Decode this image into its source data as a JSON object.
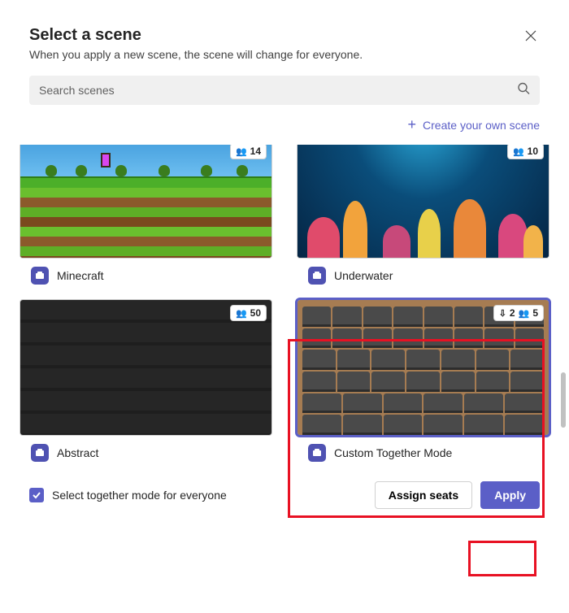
{
  "header": {
    "title": "Select a scene",
    "subtitle": "When you apply a new scene, the scene will change for everyone."
  },
  "search": {
    "placeholder": "Search scenes"
  },
  "create_link": {
    "label": "Create your own scene"
  },
  "scenes": {
    "minecraft": {
      "label": "Minecraft",
      "capacity": "14"
    },
    "underwater": {
      "label": "Underwater",
      "capacity": "10"
    },
    "abstract": {
      "label": "Abstract",
      "capacity": "50"
    },
    "custom": {
      "label": "Custom Together Mode",
      "presenters": "2",
      "capacity": "5"
    }
  },
  "footer": {
    "checkbox_label": "Select together mode for everyone",
    "checkbox_checked": true,
    "assign_label": "Assign seats",
    "apply_label": "Apply"
  }
}
